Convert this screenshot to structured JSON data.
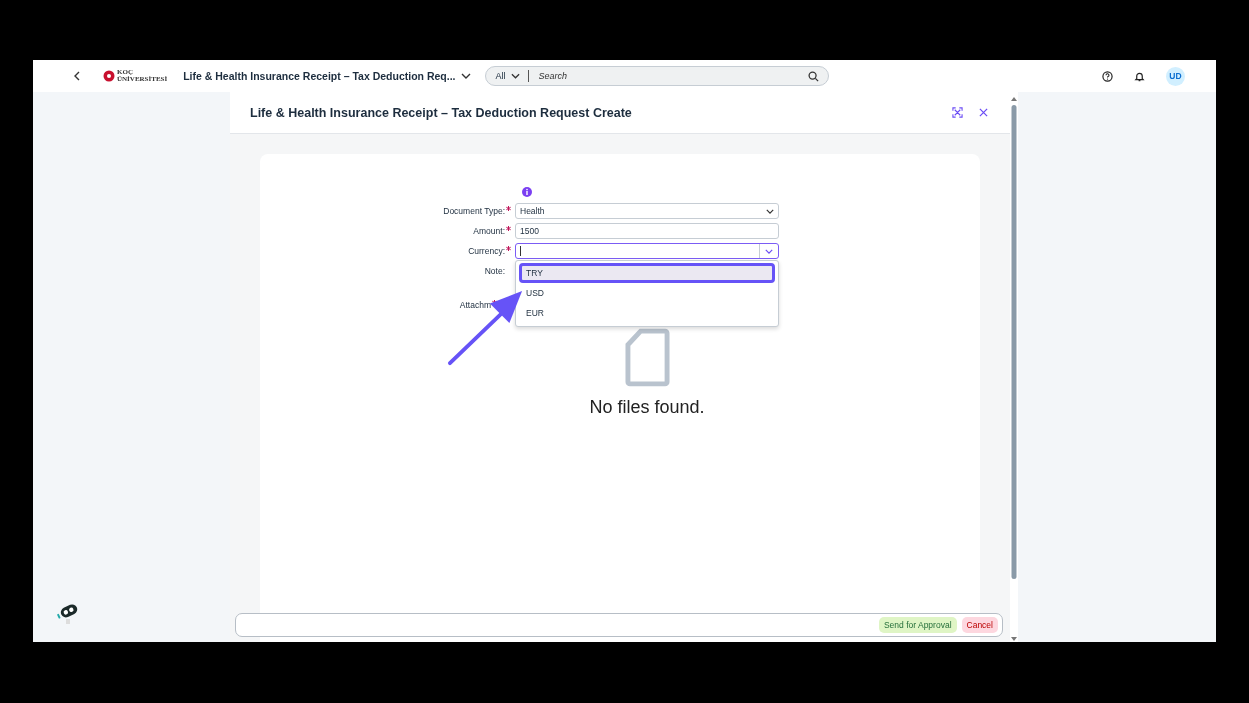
{
  "shell": {
    "logo": {
      "line_1": "KOÇ",
      "line_2": "ÜNİVERSİTESİ"
    },
    "app_title": "Life & Health Insurance Receipt – Tax Deduction Req...",
    "search": {
      "scope": "All",
      "placeholder": "Search"
    },
    "avatar": "UD"
  },
  "dialog": {
    "title": "Life & Health Insurance Receipt – Tax Deduction Request Create"
  },
  "form": {
    "fields": [
      {
        "label": "Document Type:",
        "required": true,
        "kind": "select",
        "value": "Health"
      },
      {
        "label": "Amount:",
        "required": true,
        "kind": "input",
        "value": "1500"
      },
      {
        "label": "Currency:",
        "required": true,
        "kind": "combo",
        "focused": true
      },
      {
        "label": "Note:",
        "required": false,
        "kind": "hidden"
      }
    ],
    "attachments": {
      "label": "Attachm",
      "required": true
    },
    "currency_options": [
      {
        "label": "TRY",
        "selected": true
      },
      {
        "label": "USD",
        "selected": false
      },
      {
        "label": "EUR",
        "selected": false
      }
    ],
    "empty_text": "No files found."
  },
  "footer": {
    "buttons": [
      {
        "label": "Send for Approval",
        "kind": "accept"
      },
      {
        "label": "Cancel",
        "kind": "reject"
      }
    ]
  }
}
